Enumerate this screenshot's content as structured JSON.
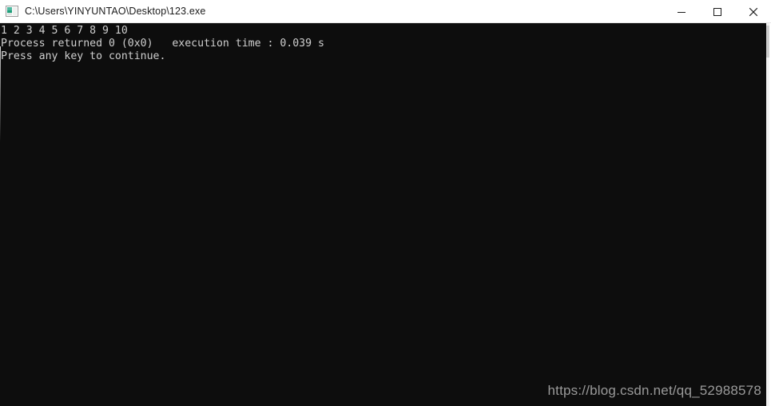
{
  "window": {
    "title": "C:\\Users\\YINYUNTAO\\Desktop\\123.exe",
    "icon": "console-window-icon",
    "title_bar_background": "#ffffff",
    "title_text_color": "#1b1b1b",
    "controls": [
      {
        "name": "minimize",
        "label": "—"
      },
      {
        "name": "maximize",
        "label": "☐"
      },
      {
        "name": "close",
        "label": "✕"
      }
    ]
  },
  "console": {
    "background": "#0d0d0d",
    "foreground": "#cfcfcf",
    "lines": [
      "1 2 3 4 5 6 7 8 9 10",
      "Process returned 0 (0x0)   execution time : 0.039 s",
      "Press any key to continue."
    ],
    "line_1": "1 2 3 4 5 6 7 8 9 10",
    "line_2": "Process returned 0 (0x0)   execution time : 0.039 s",
    "line_3": "Press any key to continue."
  },
  "watermark": {
    "text": "https://blog.csdn.net/qq_52988578",
    "color": "#9a9a9a"
  }
}
